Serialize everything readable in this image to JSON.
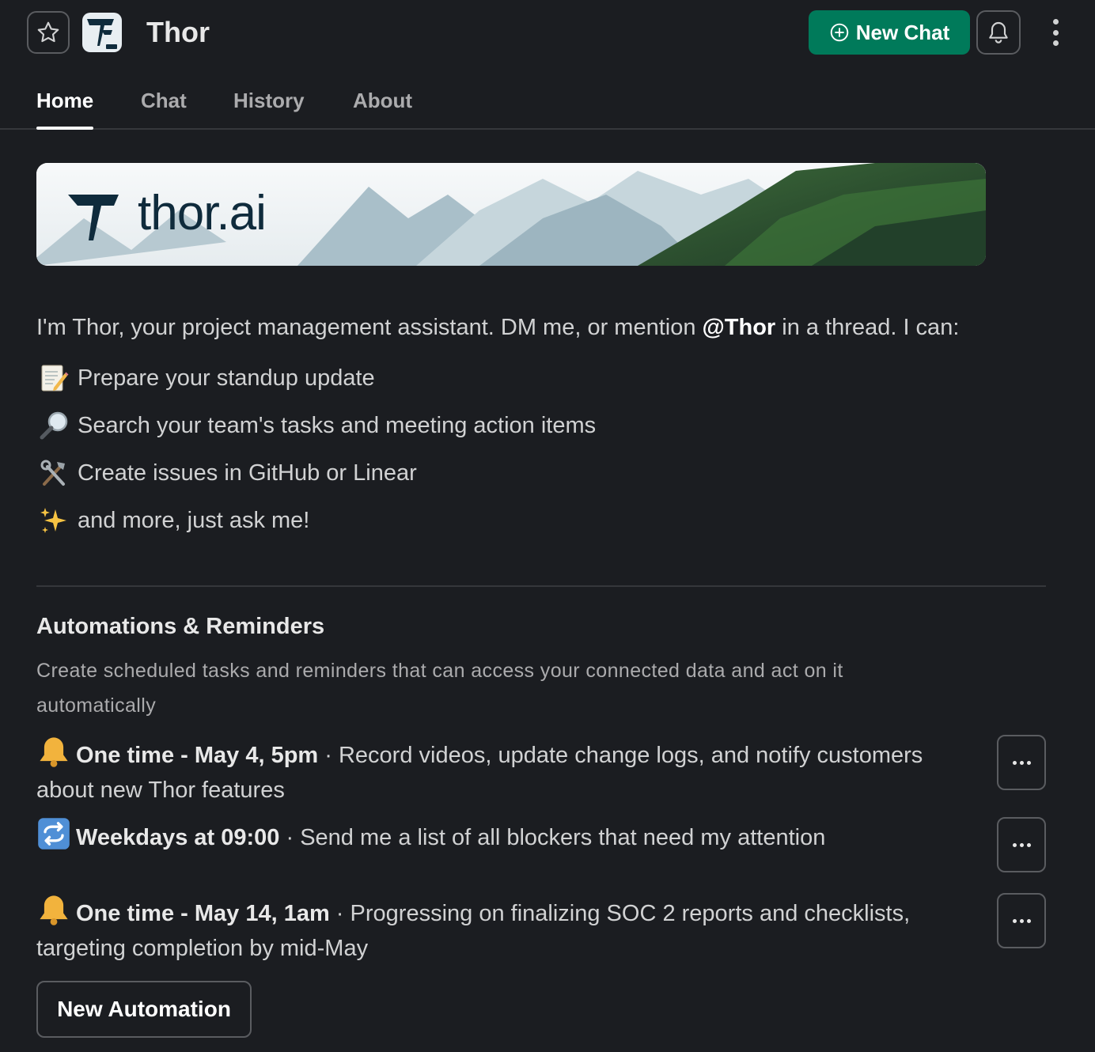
{
  "header": {
    "title": "Thor",
    "new_chat_label": "New Chat",
    "star_icon": "star-icon",
    "bell_icon": "bell-icon",
    "more_icon": "kebab-menu-icon",
    "accent_color": "#007a5a"
  },
  "tabs": [
    {
      "label": "Home",
      "active": true
    },
    {
      "label": "Chat",
      "active": false
    },
    {
      "label": "History",
      "active": false
    },
    {
      "label": "About",
      "active": false
    }
  ],
  "banner": {
    "brand_text": "thor.ai"
  },
  "intro": {
    "text_before": "I'm Thor, your project management assistant. DM me, or mention ",
    "mention": "@Thor",
    "text_after": " in a thread. I can:"
  },
  "capabilities": [
    {
      "icon": "memo-icon",
      "text": "Prepare your standup update"
    },
    {
      "icon": "magnifier-icon",
      "text": "Search your team's tasks and meeting action items"
    },
    {
      "icon": "hammer-wrench-icon",
      "text": "Create issues in GitHub or Linear"
    },
    {
      "icon": "sparkles-icon",
      "text": "and more, just ask me!"
    }
  ],
  "automations": {
    "title": "Automations & Reminders",
    "description": "Create scheduled tasks and reminders that can access your connected data and act on it automatically",
    "items": [
      {
        "icon": "bell-icon",
        "when": "One time - May 4, 5pm",
        "separator": " · ",
        "task": "Record videos, update change logs, and notify customers about new Thor features"
      },
      {
        "icon": "repeat-icon",
        "when": "Weekdays at 09:00",
        "separator": " · ",
        "task": "Send me a list of all blockers that need my attention"
      },
      {
        "icon": "bell-icon",
        "when": "One time - May 14, 1am",
        "separator": " · ",
        "task": "Progressing on finalizing SOC 2 reports and checklists, targeting completion by mid-May"
      }
    ],
    "new_button_label": "New Automation"
  }
}
